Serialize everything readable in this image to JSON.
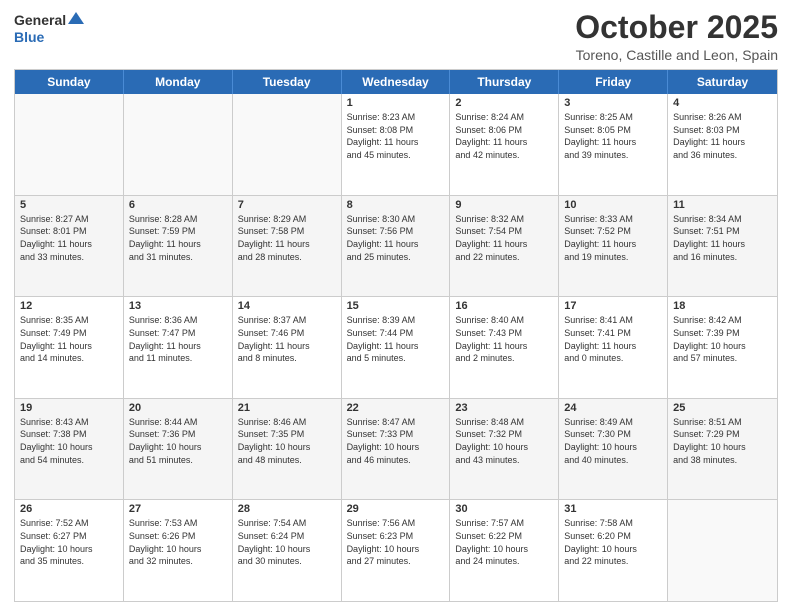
{
  "header": {
    "logo_general": "General",
    "logo_blue": "Blue",
    "month_title": "October 2025",
    "location": "Toreno, Castille and Leon, Spain"
  },
  "weekdays": [
    "Sunday",
    "Monday",
    "Tuesday",
    "Wednesday",
    "Thursday",
    "Friday",
    "Saturday"
  ],
  "rows": [
    [
      {
        "day": "",
        "text": "",
        "empty": true
      },
      {
        "day": "",
        "text": "",
        "empty": true
      },
      {
        "day": "",
        "text": "",
        "empty": true
      },
      {
        "day": "1",
        "text": "Sunrise: 8:23 AM\nSunset: 8:08 PM\nDaylight: 11 hours\nand 45 minutes."
      },
      {
        "day": "2",
        "text": "Sunrise: 8:24 AM\nSunset: 8:06 PM\nDaylight: 11 hours\nand 42 minutes."
      },
      {
        "day": "3",
        "text": "Sunrise: 8:25 AM\nSunset: 8:05 PM\nDaylight: 11 hours\nand 39 minutes."
      },
      {
        "day": "4",
        "text": "Sunrise: 8:26 AM\nSunset: 8:03 PM\nDaylight: 11 hours\nand 36 minutes."
      }
    ],
    [
      {
        "day": "5",
        "text": "Sunrise: 8:27 AM\nSunset: 8:01 PM\nDaylight: 11 hours\nand 33 minutes."
      },
      {
        "day": "6",
        "text": "Sunrise: 8:28 AM\nSunset: 7:59 PM\nDaylight: 11 hours\nand 31 minutes."
      },
      {
        "day": "7",
        "text": "Sunrise: 8:29 AM\nSunset: 7:58 PM\nDaylight: 11 hours\nand 28 minutes."
      },
      {
        "day": "8",
        "text": "Sunrise: 8:30 AM\nSunset: 7:56 PM\nDaylight: 11 hours\nand 25 minutes."
      },
      {
        "day": "9",
        "text": "Sunrise: 8:32 AM\nSunset: 7:54 PM\nDaylight: 11 hours\nand 22 minutes."
      },
      {
        "day": "10",
        "text": "Sunrise: 8:33 AM\nSunset: 7:52 PM\nDaylight: 11 hours\nand 19 minutes."
      },
      {
        "day": "11",
        "text": "Sunrise: 8:34 AM\nSunset: 7:51 PM\nDaylight: 11 hours\nand 16 minutes."
      }
    ],
    [
      {
        "day": "12",
        "text": "Sunrise: 8:35 AM\nSunset: 7:49 PM\nDaylight: 11 hours\nand 14 minutes."
      },
      {
        "day": "13",
        "text": "Sunrise: 8:36 AM\nSunset: 7:47 PM\nDaylight: 11 hours\nand 11 minutes."
      },
      {
        "day": "14",
        "text": "Sunrise: 8:37 AM\nSunset: 7:46 PM\nDaylight: 11 hours\nand 8 minutes."
      },
      {
        "day": "15",
        "text": "Sunrise: 8:39 AM\nSunset: 7:44 PM\nDaylight: 11 hours\nand 5 minutes."
      },
      {
        "day": "16",
        "text": "Sunrise: 8:40 AM\nSunset: 7:43 PM\nDaylight: 11 hours\nand 2 minutes."
      },
      {
        "day": "17",
        "text": "Sunrise: 8:41 AM\nSunset: 7:41 PM\nDaylight: 11 hours\nand 0 minutes."
      },
      {
        "day": "18",
        "text": "Sunrise: 8:42 AM\nSunset: 7:39 PM\nDaylight: 10 hours\nand 57 minutes."
      }
    ],
    [
      {
        "day": "19",
        "text": "Sunrise: 8:43 AM\nSunset: 7:38 PM\nDaylight: 10 hours\nand 54 minutes."
      },
      {
        "day": "20",
        "text": "Sunrise: 8:44 AM\nSunset: 7:36 PM\nDaylight: 10 hours\nand 51 minutes."
      },
      {
        "day": "21",
        "text": "Sunrise: 8:46 AM\nSunset: 7:35 PM\nDaylight: 10 hours\nand 48 minutes."
      },
      {
        "day": "22",
        "text": "Sunrise: 8:47 AM\nSunset: 7:33 PM\nDaylight: 10 hours\nand 46 minutes."
      },
      {
        "day": "23",
        "text": "Sunrise: 8:48 AM\nSunset: 7:32 PM\nDaylight: 10 hours\nand 43 minutes."
      },
      {
        "day": "24",
        "text": "Sunrise: 8:49 AM\nSunset: 7:30 PM\nDaylight: 10 hours\nand 40 minutes."
      },
      {
        "day": "25",
        "text": "Sunrise: 8:51 AM\nSunset: 7:29 PM\nDaylight: 10 hours\nand 38 minutes."
      }
    ],
    [
      {
        "day": "26",
        "text": "Sunrise: 7:52 AM\nSunset: 6:27 PM\nDaylight: 10 hours\nand 35 minutes."
      },
      {
        "day": "27",
        "text": "Sunrise: 7:53 AM\nSunset: 6:26 PM\nDaylight: 10 hours\nand 32 minutes."
      },
      {
        "day": "28",
        "text": "Sunrise: 7:54 AM\nSunset: 6:24 PM\nDaylight: 10 hours\nand 30 minutes."
      },
      {
        "day": "29",
        "text": "Sunrise: 7:56 AM\nSunset: 6:23 PM\nDaylight: 10 hours\nand 27 minutes."
      },
      {
        "day": "30",
        "text": "Sunrise: 7:57 AM\nSunset: 6:22 PM\nDaylight: 10 hours\nand 24 minutes."
      },
      {
        "day": "31",
        "text": "Sunrise: 7:58 AM\nSunset: 6:20 PM\nDaylight: 10 hours\nand 22 minutes."
      },
      {
        "day": "",
        "text": "",
        "empty": true
      }
    ]
  ]
}
